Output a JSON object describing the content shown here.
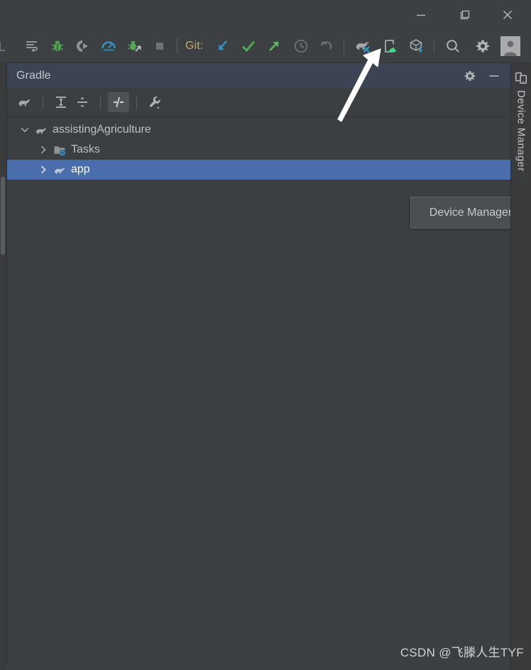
{
  "window": {
    "controls": [
      {
        "name": "minimize",
        "icon": "minimize-icon",
        "label": "Minimize"
      },
      {
        "name": "restore",
        "icon": "restore-icon",
        "label": "Restore Down"
      },
      {
        "name": "close",
        "icon": "close-icon",
        "label": "Close"
      }
    ]
  },
  "toolbar": {
    "git_label": "Git:",
    "items": [
      {
        "name": "build-variants",
        "icon": "list-undo-icon",
        "label": "Build Variants"
      },
      {
        "name": "debug",
        "icon": "debug-bug-icon",
        "label": "Debug"
      },
      {
        "name": "run-with-coverage",
        "icon": "coverage-run-icon",
        "label": "Run with Coverage"
      },
      {
        "name": "profile",
        "icon": "profiler-gauge-icon",
        "label": "Profile"
      },
      {
        "name": "attach-debugger",
        "icon": "attach-debugger-icon",
        "label": "Attach Debugger to Process"
      },
      {
        "name": "stop",
        "icon": "stop-square-icon",
        "label": "Stop"
      },
      {
        "name": "git-update",
        "icon": "arrow-down-left-blue-icon",
        "label": "Update Project"
      },
      {
        "name": "git-commit",
        "icon": "check-green-icon",
        "label": "Commit"
      },
      {
        "name": "git-push",
        "icon": "arrow-up-right-green-icon",
        "label": "Push"
      },
      {
        "name": "git-history",
        "icon": "clock-history-icon",
        "label": "History"
      },
      {
        "name": "git-rollback",
        "icon": "undo-rollback-icon",
        "label": "Rollback"
      },
      {
        "name": "sync-gradle",
        "icon": "gradle-elephant-sync-icon",
        "label": "Sync Project with Gradle Files"
      },
      {
        "name": "device-manager",
        "icon": "device-manager-icon",
        "label": "Device Manager"
      },
      {
        "name": "sdk-manager",
        "icon": "sdk-cube-download-icon",
        "label": "SDK Manager"
      },
      {
        "name": "search-everywhere",
        "icon": "search-icon",
        "label": "Search Everywhere"
      },
      {
        "name": "settings",
        "icon": "gear-icon",
        "label": "Settings"
      },
      {
        "name": "account",
        "icon": "avatar-icon",
        "label": "Account"
      }
    ]
  },
  "gradle_panel": {
    "title": "Gradle",
    "header_buttons": [
      {
        "name": "gradle-settings",
        "icon": "gear-icon",
        "label": "Gradle Settings"
      },
      {
        "name": "hide-panel",
        "icon": "minus-icon",
        "label": "Hide"
      }
    ],
    "toolbar_items": [
      {
        "name": "reload-gradle-project",
        "icon": "gradle-elephant-refresh-icon",
        "label": "Reload All Gradle Projects",
        "active": false
      },
      {
        "name": "expand-all",
        "icon": "expand-all-icon",
        "label": "Expand All",
        "active": false
      },
      {
        "name": "collapse-all",
        "icon": "collapse-all-icon",
        "label": "Collapse All",
        "active": false
      },
      {
        "name": "toggle-offline-mode",
        "icon": "offline-slash-icon",
        "label": "Toggle Offline Mode",
        "active": true
      },
      {
        "name": "gradle-tool-settings",
        "icon": "wrench-dropdown-icon",
        "label": "Gradle Settings",
        "active": false
      }
    ],
    "tree": [
      {
        "name": "tree-node-assistingagriculture",
        "label": "assistingAgriculture",
        "icon": "gradle-elephant-icon",
        "arrow": "chevron-down-icon",
        "indent": 0,
        "expanded": true,
        "selected": false
      },
      {
        "name": "tree-node-tasks",
        "label": "Tasks",
        "icon": "tasks-folder-icon",
        "arrow": "chevron-right-icon",
        "indent": 1,
        "expanded": false,
        "selected": false
      },
      {
        "name": "tree-node-app",
        "label": "app",
        "icon": "gradle-elephant-icon",
        "arrow": "chevron-right-icon",
        "indent": 1,
        "expanded": false,
        "selected": true
      }
    ]
  },
  "tooltip": {
    "text": "Device Manager"
  },
  "right_stripe": {
    "icon": "device-manager-icon",
    "label": "Device Manager"
  },
  "watermark": {
    "text": "CSDN @飞滕人生TYF"
  },
  "colors": {
    "background": "#3c3f41",
    "toolbar_bg": "#3c4042",
    "panel_header_bg": "#3c4453",
    "selection_blue": "#4a6eab",
    "text": "#bcc0c4",
    "git_label": "#c8a86a",
    "accent_green": "#4caf50",
    "accent_blue": "#3592c4",
    "tooltip_bg": "#4b4f51",
    "annotation_arrow": "#ffffff"
  }
}
